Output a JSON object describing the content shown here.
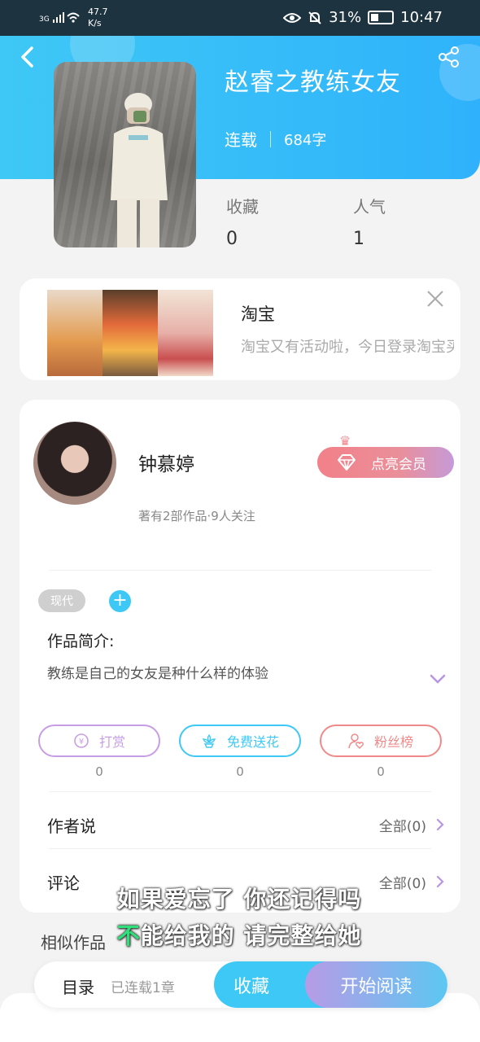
{
  "status_bar": {
    "network": "3G",
    "speed_value": "47.7",
    "speed_unit": "K/s",
    "battery": "31%",
    "time": "10:47"
  },
  "header": {
    "back_icon": "back-arrow-icon",
    "share_icon": "share-icon",
    "title": "赵睿之教练女友",
    "status": "连载",
    "word_count": "684字"
  },
  "stats": [
    {
      "label": "收藏",
      "value": "0"
    },
    {
      "label": "人气",
      "value": "1"
    }
  ],
  "ad": {
    "title": "淘宝",
    "description": "淘宝又有活动啦，今日登录淘宝买东西超便宜!"
  },
  "author": {
    "name": "钟慕婷",
    "meta": "著有2部作品·9人关注",
    "vip_label": "点亮会员"
  },
  "tags": [
    "现代"
  ],
  "intro": {
    "heading": "作品简介:",
    "text": "教练是自己的女友是种什么样的体验"
  },
  "actions": [
    {
      "label": "打赏",
      "count": "0",
      "color": "#c79ee6",
      "icon": "coin-icon"
    },
    {
      "label": "免费送花",
      "count": "0",
      "color": "#3ec8f5",
      "icon": "flower-icon"
    },
    {
      "label": "粉丝榜",
      "count": "0",
      "color": "#f08a8a",
      "icon": "fan-icon"
    }
  ],
  "sections": {
    "author_says": {
      "label": "作者说",
      "more": "全部(0)"
    },
    "comments": {
      "label": "评论",
      "more": "全部(0)"
    }
  },
  "similar_label": "相似作品",
  "subtitles": {
    "line1": "如果爱忘了 你还记得吗",
    "line2_first": "不",
    "line2_rest": "能给我的 请完整给她"
  },
  "bottom_bar": {
    "toc": "目录",
    "chapters": "已连载1章",
    "favorite": "收藏",
    "read": "开始阅读"
  },
  "colors": {
    "header": "#33bdf8",
    "accent": "#3ec8f5",
    "vip": "#f08a90",
    "read_gradient_start": "#b79be6"
  }
}
